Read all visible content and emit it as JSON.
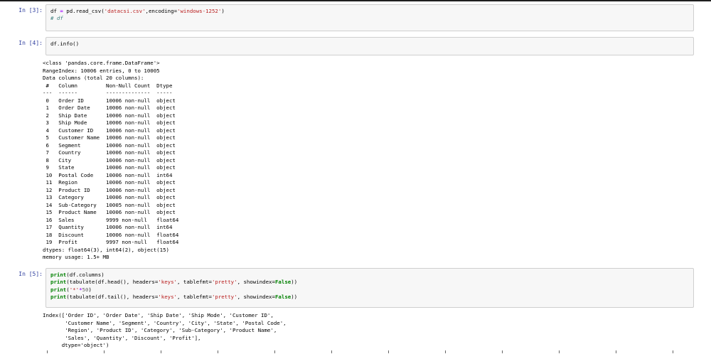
{
  "cells": [
    {
      "prompt": "In [3]:",
      "lines": [
        [
          {
            "t": "df ",
            "c": ""
          },
          {
            "t": "=",
            "c": "op"
          },
          {
            "t": " pd.read_csv(",
            "c": ""
          },
          {
            "t": "'datacsi.csv'",
            "c": "str"
          },
          {
            "t": ",encoding=",
            "c": ""
          },
          {
            "t": "'windows-1252'",
            "c": "str"
          },
          {
            "t": ")",
            "c": ""
          }
        ],
        [
          {
            "t": "# df",
            "c": "cm"
          }
        ]
      ]
    },
    {
      "prompt": "In [4]:",
      "lines": [
        [
          {
            "t": "df.info()",
            "c": ""
          }
        ]
      ],
      "output": [
        "<class 'pandas.core.frame.DataFrame'>",
        "RangeIndex: 10006 entries, 0 to 10005",
        "Data columns (total 20 columns):",
        " #   Column         Non-Null Count  Dtype  ",
        "---  ------         --------------  -----  ",
        " 0   Order ID       10006 non-null  object ",
        " 1   Order Date     10006 non-null  object ",
        " 2   Ship Date      10006 non-null  object ",
        " 3   Ship Mode      10006 non-null  object ",
        " 4   Customer ID    10006 non-null  object ",
        " 5   Customer Name  10006 non-null  object ",
        " 6   Segment        10006 non-null  object ",
        " 7   Country        10006 non-null  object ",
        " 8   City           10006 non-null  object ",
        " 9   State          10006 non-null  object ",
        " 10  Postal Code    10006 non-null  int64  ",
        " 11  Region         10006 non-null  object ",
        " 12  Product ID     10006 non-null  object ",
        " 13  Category       10006 non-null  object ",
        " 14  Sub-Category   10005 non-null  object ",
        " 15  Product Name   10006 non-null  object ",
        " 16  Sales          9999 non-null   float64",
        " 17  Quantity       10006 non-null  int64  ",
        " 18  Discount       10006 non-null  float64",
        " 19  Profit         9997 non-null   float64",
        "dtypes: float64(3), int64(2), object(15)",
        "memory usage: 1.5+ MB"
      ]
    },
    {
      "prompt": "In [5]:",
      "lines": [
        [
          {
            "t": "print",
            "c": "kw"
          },
          {
            "t": "(df.columns)",
            "c": ""
          }
        ],
        [
          {
            "t": "print",
            "c": "kw"
          },
          {
            "t": "(tabulate(df.head(), headers=",
            "c": ""
          },
          {
            "t": "'keys'",
            "c": "str"
          },
          {
            "t": ", tablefmt=",
            "c": ""
          },
          {
            "t": "'pretty'",
            "c": "str"
          },
          {
            "t": ", showindex=",
            "c": ""
          },
          {
            "t": "False",
            "c": "kw"
          },
          {
            "t": "))",
            "c": ""
          }
        ],
        [
          {
            "t": "print",
            "c": "kw"
          },
          {
            "t": "(",
            "c": ""
          },
          {
            "t": "'*'",
            "c": "str"
          },
          {
            "t": "*",
            "c": "op"
          },
          {
            "t": "50",
            "c": "num"
          },
          {
            "t": ")",
            "c": ""
          }
        ],
        [
          {
            "t": "print",
            "c": "kw"
          },
          {
            "t": "(tabulate(df.tail(), headers=",
            "c": ""
          },
          {
            "t": "'keys'",
            "c": "str"
          },
          {
            "t": ", tablefmt=",
            "c": ""
          },
          {
            "t": "'pretty'",
            "c": "str"
          },
          {
            "t": ", showindex=",
            "c": ""
          },
          {
            "t": "False",
            "c": "kw"
          },
          {
            "t": "))",
            "c": ""
          }
        ]
      ],
      "output": [
        "Index(['Order ID', 'Order Date', 'Ship Date', 'Ship Mode', 'Customer ID',",
        "       'Customer Name', 'Segment', 'Country', 'City', 'State', 'Postal Code',",
        "       'Region', 'Product ID', 'Category', 'Sub-Category', 'Product Name',",
        "       'Sales', 'Quantity', 'Discount', 'Profit'],",
        "      dtype='object')"
      ]
    }
  ]
}
